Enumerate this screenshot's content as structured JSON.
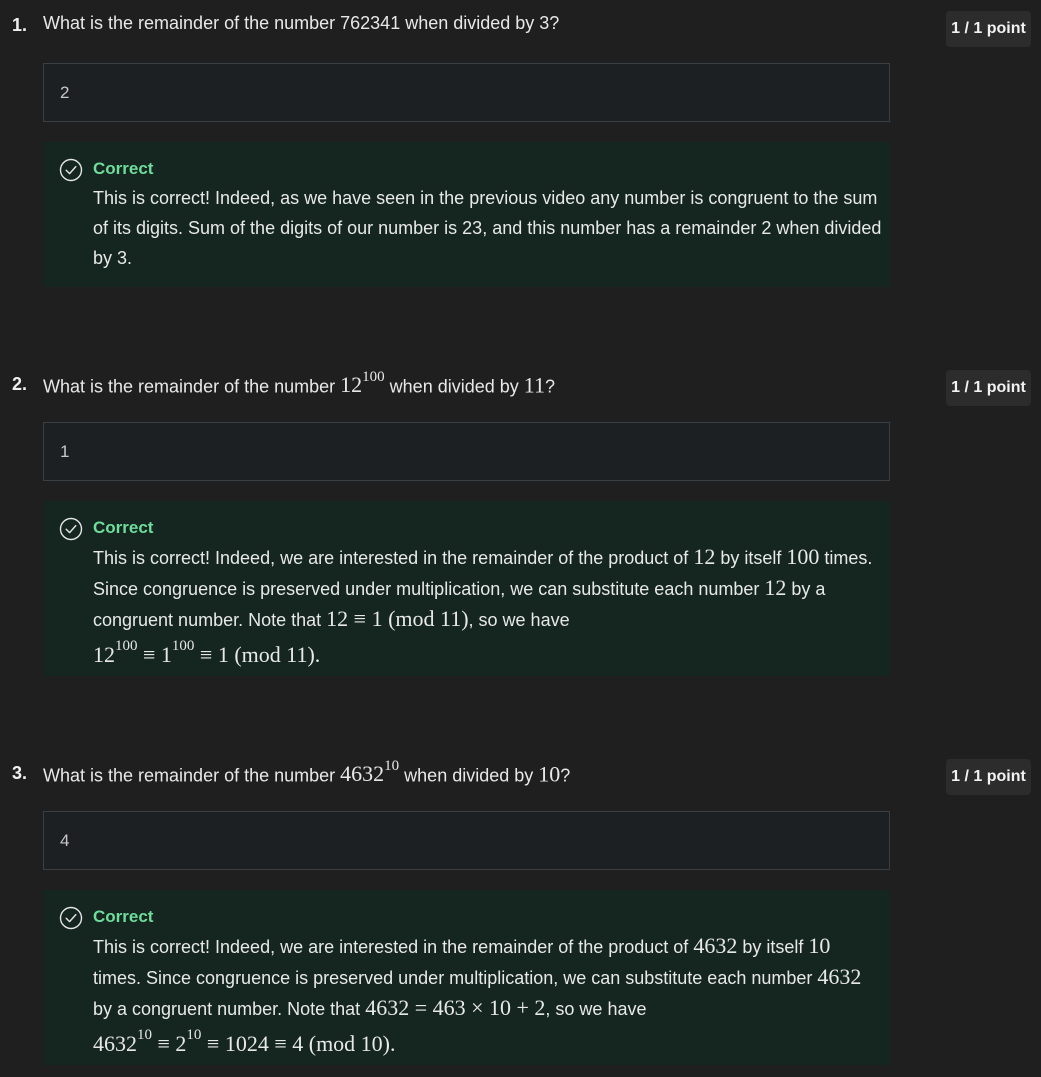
{
  "questions": [
    {
      "number": "1.",
      "question_prefix": "What is the remainder of the number 762341 when divided by 3?",
      "score": "1 / 1 point",
      "answer": "2",
      "feedback_title": "Correct",
      "feedback_text": "This is correct! Indeed, as we have seen in the previous video any number is congruent to the sum of its digits. Sum of the digits of our number is 23, and this number has a remainder 2 when divided by 3."
    },
    {
      "number": "2.",
      "question_prefix": "What is the remainder of the number",
      "question_base": "12",
      "question_exp": "100",
      "question_mid": "when divided by",
      "question_mod": "11",
      "question_suffix": "?",
      "score": "1 / 1 point",
      "answer": "1",
      "feedback_title": "Correct",
      "feedback_parts": {
        "t1": "This is correct! Indeed, we are interested in the remainder of the product of",
        "m1": "12",
        "t2": "by itself",
        "m2": "100",
        "t3": "times. Since congruence is preserved under multiplication, we can substitute each number",
        "m3": "12",
        "t4": "by a congruent number. Note that",
        "m4": "12 ≡ 1  (mod 11)",
        "t5": ", so we have",
        "m5a": "12",
        "m5a_exp": "100",
        "m5b": " ≡ 1",
        "m5b_exp": "100",
        "m5c": " ≡ 1  (mod 11)."
      }
    },
    {
      "number": "3.",
      "question_prefix": "What is the remainder of the number",
      "question_base": "4632",
      "question_exp": "10",
      "question_mid": "when divided by",
      "question_mod": "10",
      "question_suffix": "?",
      "score": "1 / 1 point",
      "answer": "4",
      "feedback_title": "Correct",
      "feedback_parts": {
        "t1": "This is correct! Indeed, we are interested in the remainder of the product of",
        "m1": "4632",
        "t2": "by itself",
        "m2": "10",
        "t3": "times. Since congruence is preserved under multiplication, we can substitute each number",
        "m3": "4632",
        "t4": "by a congruent number. Note that",
        "m4": "4632 = 463 × 10 + 2",
        "t5": ", so we have",
        "m5a": "4632",
        "m5a_exp": "10",
        "m5b": " ≡ 2",
        "m5b_exp": "10",
        "m5c": " ≡ 1024 ≡ 4  (mod 10)."
      }
    }
  ],
  "colors": {
    "background": "#1f1f1f",
    "correct_green": "#6fdc9c",
    "feedback_bg": "#14261f",
    "answer_bg": "#1c2023"
  },
  "icons": {
    "feedback": "check-circle-icon"
  }
}
